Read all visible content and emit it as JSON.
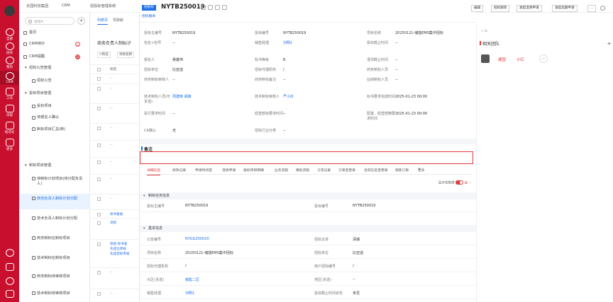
{
  "topbar": {
    "breadcrumbs": [
      "长园科技集团",
      "CRM",
      "招投标管理系统"
    ]
  },
  "rail": {
    "items": [
      {
        "label": "全部"
      },
      {
        "label": "协作"
      },
      {
        "label": "我的"
      },
      {
        "label": "CRM"
      },
      {
        "label": "工作"
      },
      {
        "label": "日程"
      },
      {
        "label": "电话号"
      },
      {
        "label": "更多"
      }
    ]
  },
  "menu": {
    "search_placeholder": "搜索A",
    "items": [
      {
        "label": "首页"
      },
      {
        "label": "CRM待办",
        "badge": "0"
      },
      {
        "label": "CRM提醒",
        "badge": "12"
      },
      {
        "label": "招标公告管理"
      },
      {
        "label": "招标公告"
      },
      {
        "label": "投标项目管理"
      },
      {
        "label": "投标项目"
      },
      {
        "label": "待报名人确认"
      },
      {
        "label": "制标项目汇总(新)"
      },
      {
        "label": "制标项目管理"
      },
      {
        "label": "待制标计划项目(待分配负责人)"
      },
      {
        "label": "商务负责人制标计划分配"
      },
      {
        "label": "技术负责人制标计划分配"
      },
      {
        "label": "商务制标在制标项目"
      },
      {
        "label": "技术制标在制标项目"
      },
      {
        "label": "商务制标待审核项目"
      },
      {
        "label": "技术制标待审核项目"
      }
    ]
  },
  "list": {
    "tabs": [
      "列表页",
      "驾驶舱"
    ],
    "title": "商务负责人制标计",
    "filter_label": "筛选",
    "filter_value": "项目名称",
    "column": "标签",
    "rows": [
      "--",
      "--",
      "--",
      "--",
      "--",
      "--",
      "--",
      "--",
      "标书复备",
      "流标",
      "标投 标书复",
      "先成已审核",
      "先成定标审核",
      "--",
      "--"
    ]
  },
  "detail": {
    "status": "招投标",
    "title": "NYTB250019",
    "subtitle": "招标跟单",
    "header_fields": [
      {
        "k": "投标主编号",
        "v": "NYTB250019"
      },
      {
        "k": "投标编号",
        "v": "NYTB250019"
      },
      {
        "k": "项目名称",
        "v": "20250121-储能EMS集中招标"
      },
      {
        "k": "包名+包号",
        "v": "--"
      },
      {
        "k": "销售经理",
        "v": "刘明1",
        "link": true
      },
      {
        "k": "投标截止时间",
        "v": "--"
      },
      {
        "k": "报名人",
        "v": "吴雄伟"
      },
      {
        "k": "标书等级",
        "v": "B"
      },
      {
        "k": "澄清截止时间",
        "v": "--"
      },
      {
        "k": "招标单位",
        "v": "比亚迪"
      },
      {
        "k": "招标代理机构",
        "v": "/"
      },
      {
        "k": "商务制标人员",
        "v": "--"
      },
      {
        "k": "商务制标审核人",
        "v": "--"
      },
      {
        "k": "商务制标备注",
        "v": "--"
      },
      {
        "k": "业绩制标人员",
        "v": "--"
      },
      {
        "k": "技术制标人员(可多选)",
        "v": "周建锋 胡婧",
        "link": true
      },
      {
        "k": "技术制标审核人",
        "v": "严小红",
        "link": true
      },
      {
        "k": "标书要求完成时间",
        "v": "2025-01-23 00:00"
      },
      {
        "k": "投行要求时间",
        "v": "--"
      },
      {
        "k": "经营部标要求时间",
        "v": "--"
      },
      {
        "k": "配置、经营部精要求时间",
        "v": "2025-01-23 00:00"
      },
      {
        "k": "CA确认",
        "v": "无"
      },
      {
        "k": "招标行业分类",
        "v": "--"
      }
    ],
    "remark_label": "备注",
    "tabs": [
      "详细信息",
      "修改记录",
      "申请时间变",
      "澄清申请",
      "投标项目明细",
      "业务流程",
      "审批流程",
      "订货记录",
      "订单变更单",
      "合同信息变更单",
      "销售订单",
      "更多"
    ],
    "toggle_label": "显示空数值",
    "groups": [
      {
        "title": "制标任务信息",
        "rows": [
          [
            {
              "k": "投标主编号",
              "v": "NYTB250019"
            },
            {
              "k": "投标编号",
              "v": "NYTB250019"
            }
          ]
        ]
      },
      {
        "title": "基本信息",
        "rows": [
          [
            {
              "k": "公告编号",
              "v": "NYGG250020",
              "link": true
            },
            {
              "k": "招标主体",
              "v": "深瑞"
            }
          ],
          [
            {
              "k": "项目名称",
              "v": "20250121-储能EMS集中招标"
            },
            {
              "k": "招标单位",
              "v": "比亚迪"
            }
          ],
          [
            {
              "k": "招标代理机构",
              "v": "/"
            },
            {
              "k": "用户招标编号",
              "v": "/"
            }
          ],
          [
            {
              "k": "大区(多选)",
              "v": "销售二区",
              "link": true
            },
            {
              "k": "地区(多选)",
              "v": "--"
            }
          ],
          [
            {
              "k": "销售经理",
              "v": "刘明1",
              "link": true
            },
            {
              "k": "投标截止时间状态",
              "v": "未至"
            }
          ]
        ]
      }
    ]
  },
  "actions": [
    "编辑",
    "招标跟单",
    "发起澄清申请",
    "发起延期申请",
    "..."
  ],
  "rpanel": {
    "title": "相关团队",
    "members": [
      "建国",
      "小红"
    ]
  },
  "colors": {
    "rail": "#c8102e",
    "accent": "#1f6fe8",
    "highlight": "#e03a3a"
  }
}
